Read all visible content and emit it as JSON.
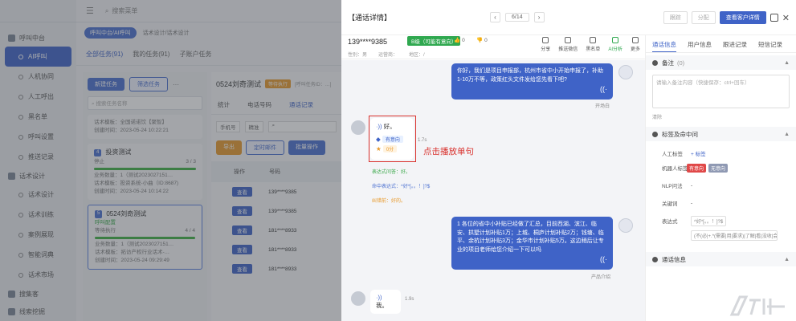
{
  "sidebar": {
    "groups": [
      {
        "label": "呼叫中台",
        "items": [
          {
            "label": "AI呼叫",
            "active": true
          },
          {
            "label": "人机协同"
          },
          {
            "label": "人工呼出"
          },
          {
            "label": "黑名单"
          },
          {
            "label": "呼叫设置"
          },
          {
            "label": "推送记录"
          }
        ]
      },
      {
        "label": "话术设计",
        "items": [
          {
            "label": "话术设计"
          },
          {
            "label": "话术训练"
          },
          {
            "label": "案例展现"
          },
          {
            "label": "智能词典"
          },
          {
            "label": "话术市场"
          }
        ]
      },
      {
        "label": "搜集客",
        "items": []
      },
      {
        "label": "线索挖掘",
        "items": []
      }
    ]
  },
  "main": {
    "search_placeholder": "搜索菜单",
    "breadcrumb_chips": [
      "呼叫中台/AI呼叫",
      "话术设计/话术设计"
    ],
    "tabs": [
      "全部任务(91)",
      "我的任务(91)",
      "子账户任务"
    ],
    "new_task": "新建任务",
    "filter_task": "筛选任务",
    "more": "···",
    "task_search_placeholder": "搜索任务名称",
    "tasks": [
      {
        "num": "",
        "name": "",
        "lines": [
          "话术模板：全国诺诺饮【聚智】",
          "创建时间：2023-05-24 10:22:21"
        ]
      },
      {
        "num": "4",
        "name": "投资测试",
        "status": "停止",
        "progress": "3 / 3",
        "lines": [
          "业务数量：1（测试2023027151…",
          "话术模板：投资系统-小曲（ID:8687)",
          "创建时间：2023-05-24 10:14:22"
        ]
      },
      {
        "num": "5",
        "name": "0524刘奇测试",
        "sub": "呼叫配置",
        "status": "等待执行",
        "progress": "4 / 4",
        "lines": [
          "业务数量：1（测试2023027151…",
          "话术模板：拓访产权行业话术-…",
          "创建时间：2023-05-24 09:29:49"
        ]
      }
    ],
    "detail_title": "0524刘奇测试",
    "detail_badge": "等待执行",
    "detail_sub": "[呼叫任务ID：…]",
    "detail_tabs": [
      "统计",
      "电话号码",
      "通话记录"
    ],
    "filters": [
      "手机号",
      "精准",
      ""
    ],
    "actions": [
      "导出",
      "定时邮件",
      "批量操作"
    ],
    "table_headers": [
      "操作",
      "号码"
    ],
    "table_rows": [
      {
        "op": "查看",
        "num": "139****9385"
      },
      {
        "op": "查看",
        "num": "139****9385"
      },
      {
        "op": "查看",
        "num": "181****8933"
      },
      {
        "op": "查看",
        "num": "181****8933"
      },
      {
        "op": "查看",
        "num": "181****8933"
      }
    ]
  },
  "drawer": {
    "title": "【通话详情】",
    "pager": "6/14",
    "prev": "‹",
    "next": "›",
    "btn_follow": "跟踪",
    "btn_assign": "分配",
    "btn_customer": "查看客户详情",
    "phone": "139****9385",
    "level": "B级（可能有意向）",
    "likes": "0",
    "dislikes": "0",
    "meta": [
      "性别：男",
      "运营商：",
      "地区：/"
    ],
    "actions": [
      "分享",
      "推送微信",
      "黑名单",
      "AI分析",
      "更多"
    ],
    "chat": [
      {
        "side": "right",
        "text": "你好，我们是项目申报部，杭州市省中小开始申报了，补助1-10万不等，政策红头文件发给您先看下吧?",
        "caption": "开场白"
      },
      {
        "side": "left",
        "text": "好。",
        "duration": "1.7s",
        "intent": "有意向",
        "score": "0分",
        "hit_question": "表达式问答：好。",
        "hit_expr": "命中表达式：^好*[。。！]?$",
        "correct": "纠错前：好的。"
      },
      {
        "side": "right",
        "text": "1 各位的省中小补贴已经做了汇总，目前西湖、滨江、临安、拱墅计划补贴1万；上城、桐庐计划补贴2万；钱塘、临平、余杭计划补贴3万；金华市计划补贴5万。这边稍后让专业的项目老师给您介绍一下可以吗",
        "caption": "产品介绍"
      },
      {
        "side": "left",
        "text": "我。",
        "duration": "1.9s"
      }
    ],
    "annotation": "点击播放单句",
    "right_tabs": [
      "通话信息",
      "用户信息",
      "跟进记录",
      "短信记录"
    ],
    "note_title": "备注",
    "note_count": "(0)",
    "note_placeholder": "请输入备注内容（快捷保存：ctrl+回车）",
    "clear": "清除",
    "tags_title": "标签及命中问",
    "manual_tag_label": "人工标签",
    "add_tag": "+ 标签",
    "robot_tag_label": "机器人标签",
    "robot_tags": [
      "有意向",
      "无意向"
    ],
    "nlp_label": "NLP问法",
    "nlp_value": "-",
    "keyword_label": "关键词",
    "keyword_value": "-",
    "expr_label": "表达式",
    "expr_values": [
      "^好*[。。！]?$",
      "(不(必|+.*(需要|用|要求)|了解|看|没收|会|..."
    ],
    "call_info_title": "通话信息"
  },
  "colors": {
    "primary": "#3f63c7",
    "green": "#2fa84f",
    "red": "#d9302c"
  }
}
